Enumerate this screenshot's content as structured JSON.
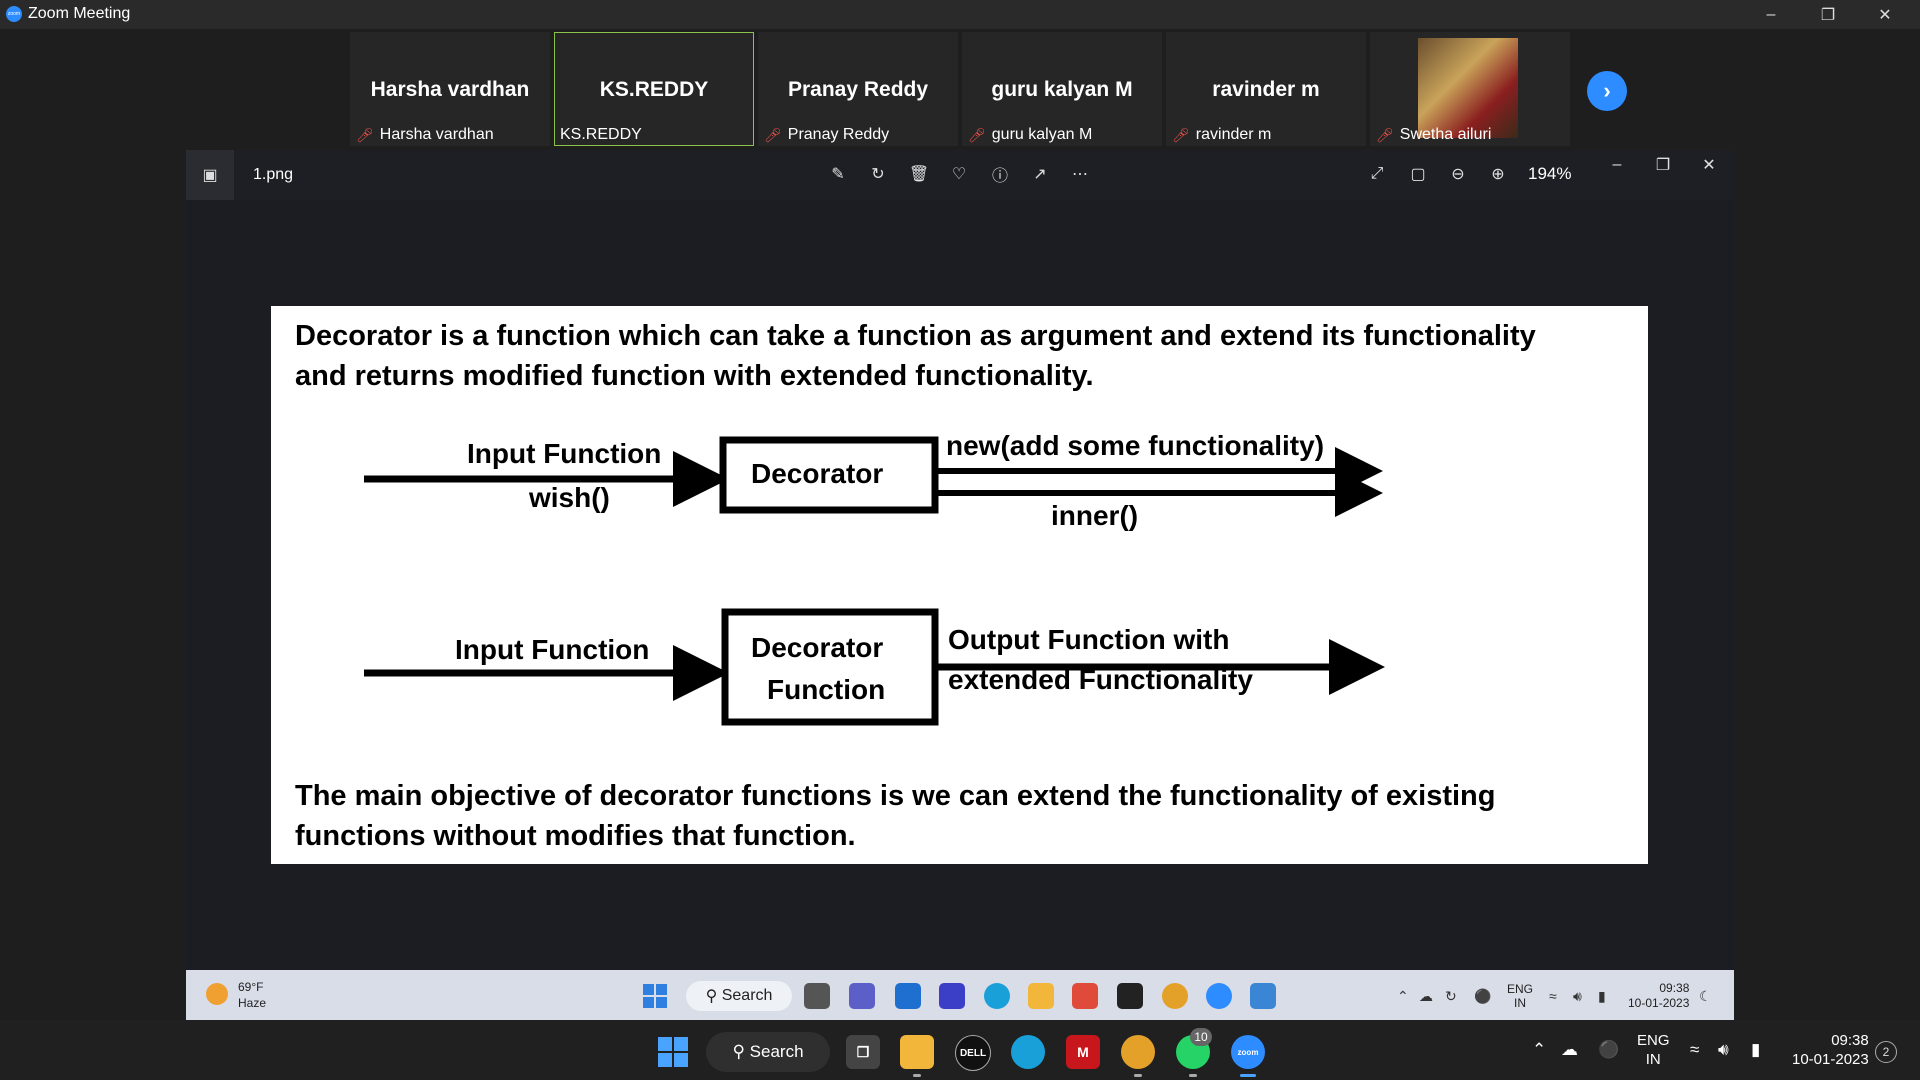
{
  "window": {
    "title": "Zoom Meeting"
  },
  "participants": [
    {
      "display_name": "Harsha vardhan",
      "footer_name": "Harsha vardhan",
      "muted": true,
      "active": false
    },
    {
      "display_name": "KS.REDDY",
      "footer_name": "KS.REDDY",
      "muted": false,
      "active": true
    },
    {
      "display_name": "Pranay Reddy",
      "footer_name": "Pranay Reddy",
      "muted": true,
      "active": false
    },
    {
      "display_name": "guru kalyan M",
      "footer_name": "guru kalyan M",
      "muted": true,
      "active": false
    },
    {
      "display_name": "ravinder m",
      "footer_name": "ravinder m",
      "muted": true,
      "active": false
    },
    {
      "display_name": "",
      "footer_name": "Swetha ailuri",
      "muted": true,
      "active": false
    }
  ],
  "photos_viewer": {
    "file_name": "1.png",
    "zoom_level": "194%",
    "toolbar_icons": [
      "edit-icon",
      "rotate-icon",
      "delete-icon",
      "favorite-icon",
      "info-icon",
      "share-icon",
      "more-icon"
    ],
    "view_icons": [
      "expand-icon",
      "fit-icon",
      "zoom-out-icon",
      "zoom-in-icon"
    ]
  },
  "slide": {
    "intro_line1": "Decorator is a function which can take a function as argument and extend its functionality",
    "intro_line2": "and returns modified function with extended functionality.",
    "diagram1": {
      "input_label": "Input Function",
      "input_sub": "wish()",
      "box_label": "Decorator",
      "output_label": "new(add some  functionality)",
      "output_sub": "inner()"
    },
    "diagram2": {
      "input_label": "Input Function",
      "box_line1": "Decorator",
      "box_line2": "Function",
      "output_line1": "Output Function with",
      "output_line2": "extended Functionality"
    },
    "outro_line1": "The main objective of decorator functions is we can extend the functionality of existing",
    "outro_line2": "functions without modifies that function."
  },
  "inner_taskbar": {
    "temperature": "69°F",
    "condition": "Haze",
    "search_label": "Search",
    "lang_line1": "ENG",
    "lang_line2": "IN",
    "time": "09:38",
    "date": "10-01-2023"
  },
  "taskbar": {
    "search_label": "Search",
    "whatsapp_badge": "10",
    "lang_line1": "ENG",
    "lang_line2": "IN",
    "time": "09:38",
    "date": "10-01-2023",
    "notification_count": "2"
  }
}
